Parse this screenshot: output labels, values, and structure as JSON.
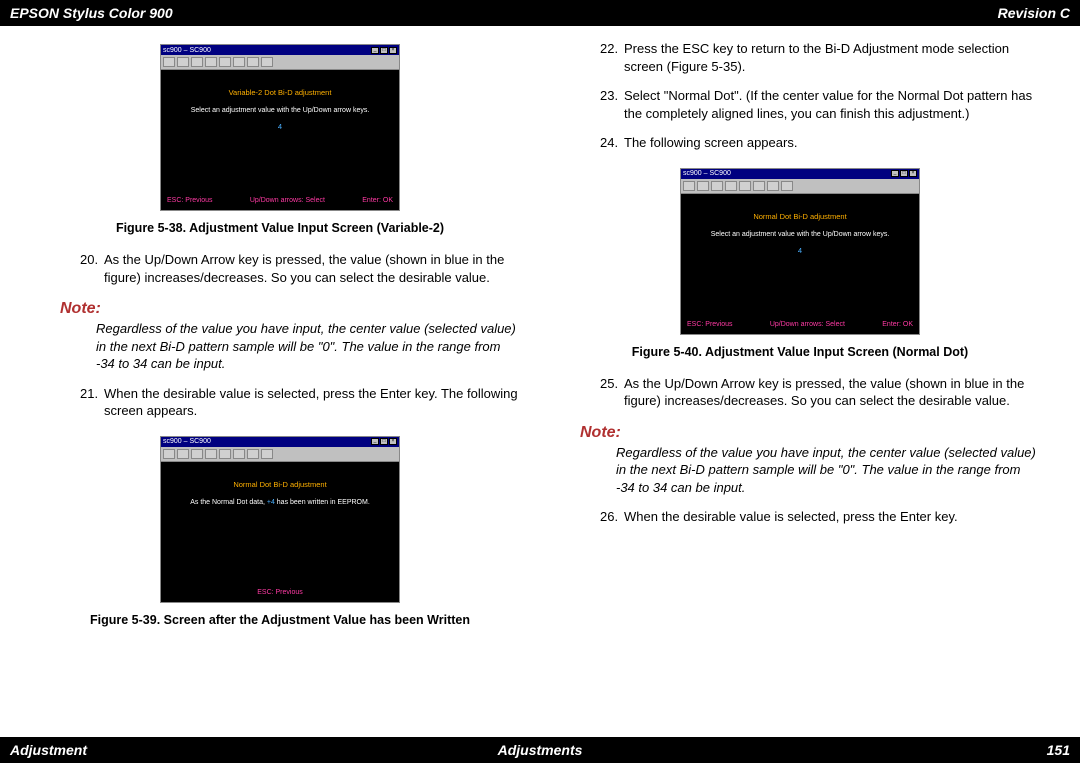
{
  "header": {
    "left": "EPSON Stylus Color 900",
    "right": "Revision C"
  },
  "footer": {
    "left": "Adjustment",
    "center": "Adjustments",
    "right": "151"
  },
  "left": {
    "fig38": {
      "title": "sc900 – SC900",
      "heading": "Variable-2 Dot Bi-D adjustment",
      "line1": "Select an adjustment value with the Up/Down arrow keys.",
      "value": "4",
      "foot_left": "ESC: Previous",
      "foot_mid": "Up/Down arrows: Select",
      "foot_right": "Enter: OK",
      "caption": "Figure 5-38.  Adjustment Value Input Screen (Variable-2)"
    },
    "step20": {
      "num": "20.",
      "text": "As the Up/Down Arrow key is pressed, the value (shown in blue in the figure) increases/decreases. So you can select the desirable value."
    },
    "note1": {
      "label": "Note:",
      "body": "Regardless of the value you have input, the center value (selected value) in the next Bi-D pattern sample will be \"0\". The value in the range from -34 to 34 can be input."
    },
    "step21": {
      "num": "21.",
      "text": "When the desirable value is selected, press the Enter key. The following screen appears."
    },
    "fig39": {
      "title": "sc900 – SC900",
      "heading": "Normal Dot Bi-D adjustment",
      "line_pre": "As the Normal Dot data, ",
      "line_val": "+4",
      "line_post": " has been written in EEPROM.",
      "foot_left": "ESC: Previous",
      "caption": "Figure 5-39.  Screen after the Adjustment Value has been Written"
    }
  },
  "right": {
    "step22": {
      "num": "22.",
      "text": "Press the ESC key to return to the Bi-D Adjustment mode selection screen (Figure 5-35)."
    },
    "step23": {
      "num": "23.",
      "text": "Select \"Normal Dot\". (If the center value for the Normal Dot pattern has the completely aligned lines, you can finish this adjustment.)"
    },
    "step24": {
      "num": "24.",
      "text": "The following screen appears."
    },
    "fig40": {
      "title": "sc900 – SC900",
      "heading": "Normal Dot Bi-D adjustment",
      "line1": "Select an adjustment value with the Up/Down arrow keys.",
      "value": "4",
      "foot_left": "ESC: Previous",
      "foot_mid": "Up/Down arrows: Select",
      "foot_right": "Enter: OK",
      "caption": "Figure 5-40.  Adjustment Value Input Screen (Normal Dot)"
    },
    "step25": {
      "num": "25.",
      "text": "As the Up/Down Arrow key is pressed, the value (shown in blue in the figure) increases/decreases. So you can select the desirable value."
    },
    "note2": {
      "label": "Note:",
      "body": "Regardless of the value you have input, the center value (selected value) in the next Bi-D pattern sample will be \"0\". The value in the range from -34 to 34 can be input."
    },
    "step26": {
      "num": "26.",
      "text": "When the desirable value is selected, press the Enter key."
    }
  }
}
